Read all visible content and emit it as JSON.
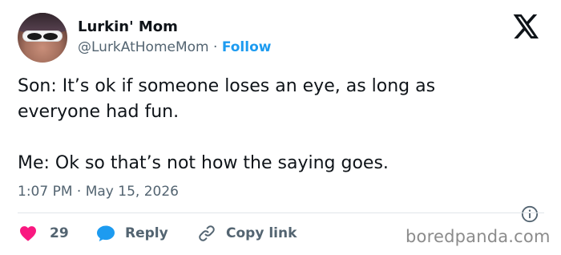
{
  "author": {
    "name": "Lurkin' Mom",
    "handle": "@LurkAtHomeMom",
    "separator": "·",
    "follow_label": "Follow"
  },
  "tweet": {
    "line1": "Son: It’s ok if someone loses an eye, as long as",
    "line2": "everyone had fun.",
    "line3": "Me: Ok so that’s not how the saying goes.",
    "timestamp": "1:07 PM · May 15, 2026"
  },
  "actions": {
    "likes": "29",
    "reply_label": "Reply",
    "copy_label": "Copy link"
  },
  "icons": {
    "brand": "x-logo-icon",
    "info": "info-icon",
    "like": "heart-icon",
    "reply": "speech-bubble-icon",
    "copy": "link-icon"
  },
  "colors": {
    "accent": "#1d9bf0",
    "heart": "#f91880",
    "text": "#0f1419",
    "muted": "#536471"
  },
  "watermark": "boredpanda.com"
}
